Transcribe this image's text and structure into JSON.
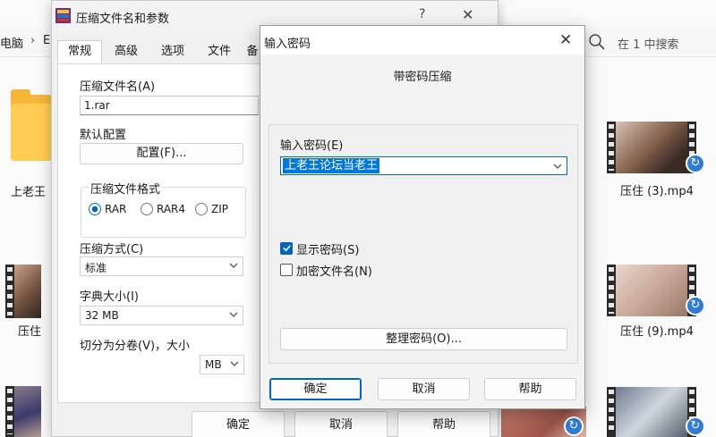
{
  "explorer": {
    "path_root": "电脑",
    "path_sep": "›",
    "path_drive": "E:",
    "search_placeholder": "在 1 中搜索",
    "folder_label": "上老王",
    "videos": [
      {
        "label": "压住 (3).mp4"
      },
      {
        "label": "压住 (9).mp4"
      },
      {
        "label": "压住"
      }
    ]
  },
  "rar_dialog": {
    "title": "压缩文件名和参数",
    "help": "?",
    "close": "✕",
    "tabs": [
      "常规",
      "高级",
      "选项",
      "文件",
      "备"
    ],
    "archive_name_label": "压缩文件名(A)",
    "archive_name_value": "1.rar",
    "default_profile_label": "默认配置",
    "profile_button": "配置(F)...",
    "format_group_label": "压缩文件格式",
    "formats": [
      "RAR",
      "RAR4",
      "ZIP"
    ],
    "selected_format": "RAR",
    "method_label": "压缩方式(C)",
    "method_value": "标准",
    "dict_label": "字典大小(I)",
    "dict_value": "32 MB",
    "split_label": "切分为分卷(V)，大小",
    "split_unit": "MB",
    "ok": "确定",
    "cancel": "取消",
    "help_btn": "帮助"
  },
  "pwd_dialog": {
    "title": "输入密码",
    "close": "✕",
    "heading": "带密码压缩",
    "input_label": "输入密码(E)",
    "password_value": "上老王论坛当老王",
    "show_password_label": "显示密码(S)",
    "show_password_checked": true,
    "encrypt_names_label": "加密文件名(N)",
    "encrypt_names_checked": false,
    "organize_button": "整理密码(O)...",
    "ok": "确定",
    "cancel": "取消",
    "help": "帮助"
  }
}
